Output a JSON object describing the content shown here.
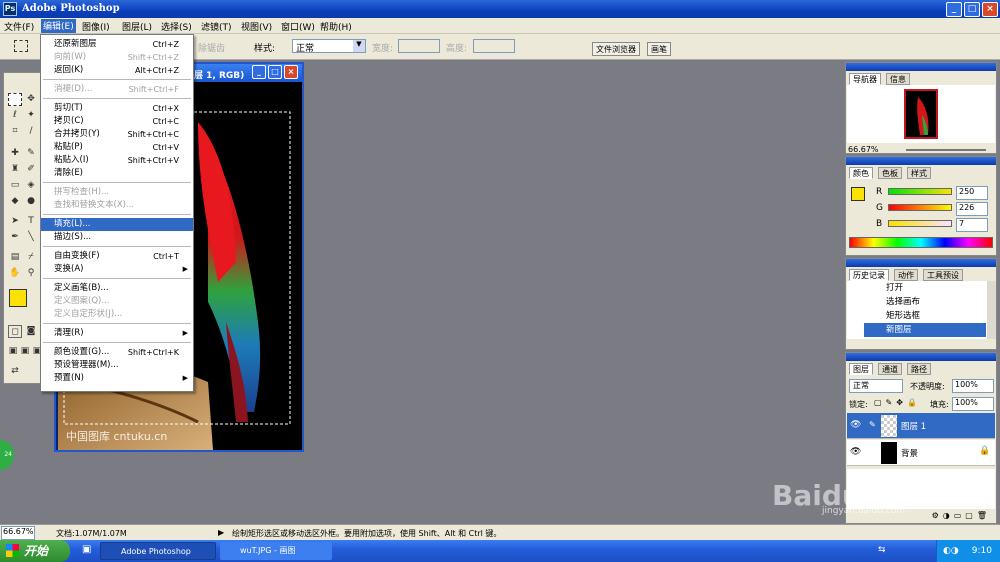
{
  "app": {
    "title": "Adobe Photoshop"
  },
  "menubar": [
    "文件(F)",
    "编辑(E)",
    "图像(I)",
    "图层(L)",
    "选择(S)",
    "滤镜(T)",
    "视图(V)",
    "窗口(W)",
    "帮助(H)"
  ],
  "options": {
    "feather_partial": "除锯齿",
    "style_label": "样式:",
    "style_value": "正常",
    "width_label": "宽度:",
    "height_label": "高度:",
    "tab_file_browser": "文件浏览器",
    "tab_brush": "画笔"
  },
  "document": {
    "title": "层 1, RGB)",
    "watermark": "中国图库 cntuku.cn"
  },
  "edit_menu": [
    {
      "label": "还原新图层",
      "shortcut": "Ctrl+Z",
      "disabled": false
    },
    {
      "label": "向前(W)",
      "shortcut": "Shift+Ctrl+Z",
      "disabled": true
    },
    {
      "label": "返回(K)",
      "shortcut": "Alt+Ctrl+Z",
      "disabled": false
    },
    {
      "label": "消褪(D)...",
      "shortcut": "Shift+Ctrl+F",
      "disabled": true
    },
    {
      "label": "剪切(T)",
      "shortcut": "Ctrl+X",
      "disabled": false
    },
    {
      "label": "拷贝(C)",
      "shortcut": "Ctrl+C",
      "disabled": false
    },
    {
      "label": "合并拷贝(Y)",
      "shortcut": "Shift+Ctrl+C",
      "disabled": false
    },
    {
      "label": "粘贴(P)",
      "shortcut": "Ctrl+V",
      "disabled": false
    },
    {
      "label": "粘贴入(I)",
      "shortcut": "Shift+Ctrl+V",
      "disabled": false
    },
    {
      "label": "清除(E)",
      "shortcut": "",
      "disabled": false
    },
    {
      "label": "拼写检查(H)...",
      "shortcut": "",
      "disabled": true
    },
    {
      "label": "查找和替换文本(X)...",
      "shortcut": "",
      "disabled": true
    },
    {
      "label": "填充(L)...",
      "shortcut": "",
      "disabled": false,
      "highlight": true
    },
    {
      "label": "描边(S)...",
      "shortcut": "",
      "disabled": false
    },
    {
      "label": "自由变换(F)",
      "shortcut": "Ctrl+T",
      "disabled": false
    },
    {
      "label": "变换(A)",
      "shortcut": "",
      "disabled": false,
      "submenu": true
    },
    {
      "label": "定义画笔(B)...",
      "shortcut": "",
      "disabled": false
    },
    {
      "label": "定义图案(Q)...",
      "shortcut": "",
      "disabled": true
    },
    {
      "label": "定义自定形状(J)...",
      "shortcut": "",
      "disabled": true
    },
    {
      "label": "清理(R)",
      "shortcut": "",
      "disabled": false,
      "submenu": true
    },
    {
      "label": "颜色设置(G)...",
      "shortcut": "Shift+Ctrl+K",
      "disabled": false
    },
    {
      "label": "预设管理器(M)...",
      "shortcut": "",
      "disabled": false
    },
    {
      "label": "预置(N)",
      "shortcut": "",
      "disabled": false,
      "submenu": true
    }
  ],
  "navigator": {
    "tab1": "导航器",
    "tab2": "信息",
    "zoom": "66.67%"
  },
  "color": {
    "tab1": "颜色",
    "tab2": "色板",
    "tab3": "样式",
    "r_label": "R",
    "g_label": "G",
    "b_label": "B",
    "r": "250",
    "g": "226",
    "b": "7",
    "fg_color": "#fae207"
  },
  "history": {
    "tab1": "历史记录",
    "tab2": "动作",
    "tab3": "工具预设",
    "items": [
      "打开",
      "选择画布",
      "矩形选框",
      "新图层"
    ]
  },
  "layers": {
    "tab1": "图层",
    "tab2": "通道",
    "tab3": "路径",
    "blend": "正常",
    "opacity_label": "不透明度:",
    "opacity": "100%",
    "lock_label": "锁定:",
    "fill_label": "填充:",
    "fill": "100%",
    "items": [
      "图层 1",
      "背景"
    ]
  },
  "status": {
    "zoom": "66.67%",
    "doc": "文档:1.07M/1.07M",
    "hint": "绘制矩形选区或移动选区外框。要用附加选项，使用 Shift、Alt 和 Ctrl 键。"
  },
  "taskbar": {
    "start": "开始",
    "task1": "Adobe Photoshop",
    "task2": "wuT.JPG - 画图",
    "time": "9:10"
  },
  "watermark_site": {
    "brand": "Baidu经验",
    "url": "jingyan.baidu.com"
  }
}
